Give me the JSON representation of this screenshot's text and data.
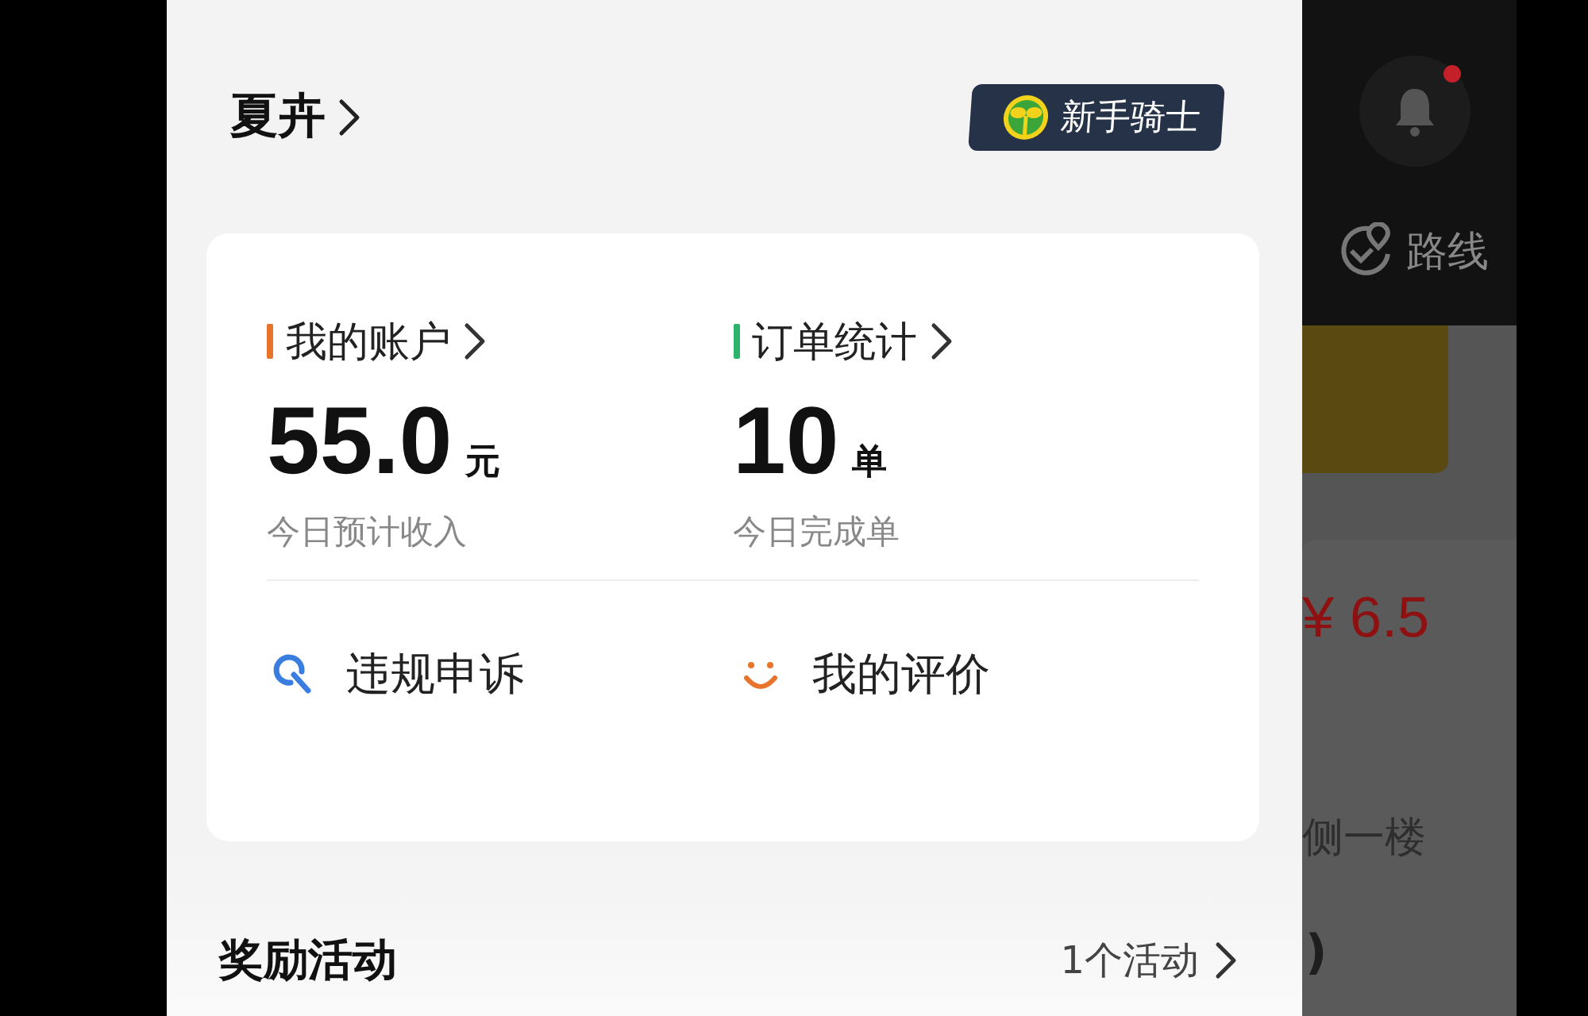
{
  "profile": {
    "name": "夏卉",
    "badge": "新手骑士"
  },
  "summary": {
    "stats": [
      {
        "title": "我的账户",
        "color": "#e8742c",
        "value": "55.0",
        "unit": "元",
        "caption": "今日预计收入"
      },
      {
        "title": "订单统计",
        "color": "#2db36b",
        "value": "10",
        "unit": "单",
        "caption": "今日完成单"
      }
    ],
    "links": [
      {
        "kind": "appeal",
        "label": "违规申诉"
      },
      {
        "kind": "rating",
        "label": "我的评价"
      }
    ]
  },
  "rewards": {
    "title": "奖励活动",
    "count": "1个活动"
  },
  "background_app": {
    "notification_dot": true,
    "route_label": "路线",
    "price": "¥ 6.5",
    "address_fragment": "侧一楼",
    "text_fragment": ")"
  }
}
